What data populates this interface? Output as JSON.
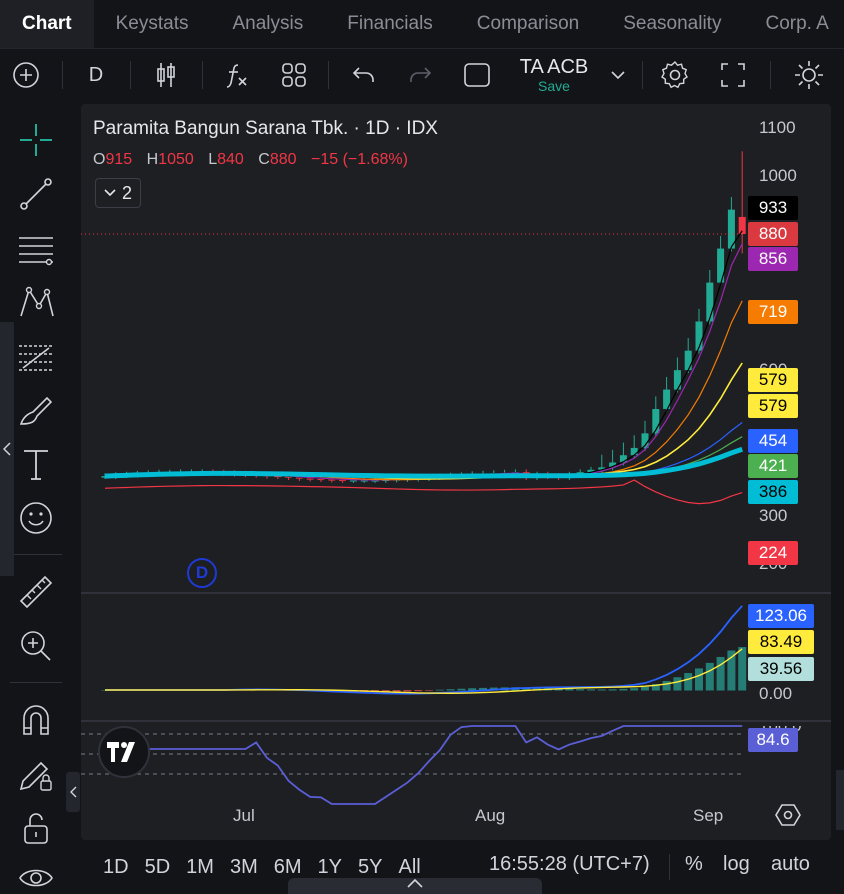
{
  "tabs": [
    {
      "label": "Chart",
      "active": true
    },
    {
      "label": "Keystats"
    },
    {
      "label": "Analysis"
    },
    {
      "label": "Financials"
    },
    {
      "label": "Comparison"
    },
    {
      "label": "Seasonality"
    },
    {
      "label": "Corp. A"
    }
  ],
  "toolbar": {
    "interval": "D",
    "symbol": "TA ACB",
    "save_label": "Save"
  },
  "legend": {
    "title": "Paramita Bangun Sarana Tbk. · 1D · IDX",
    "o_label": "O",
    "o_value": "915",
    "h_label": "H",
    "h_value": "1050",
    "l_label": "L",
    "l_value": "840",
    "c_label": "C",
    "c_value": "880",
    "change": "−15 (−1.68%)",
    "indicators_count": "2"
  },
  "price_axis": {
    "ticks": [
      "1100",
      "1000",
      "300",
      "200"
    ],
    "partial_ticks": [
      "600"
    ],
    "tags": [
      {
        "value": "933",
        "bg": "#000000",
        "fg": "#ffffff"
      },
      {
        "value": "880",
        "bg": "#d9393f",
        "fg": "#ffffff"
      },
      {
        "value": "856",
        "bg": "#9c27b0",
        "fg": "#ffffff"
      },
      {
        "value": "719",
        "bg": "#f57c00",
        "fg": "#ffffff"
      },
      {
        "value": "579",
        "bg": "#ffeb3b",
        "fg": "#000000"
      },
      {
        "value": "579",
        "bg": "#ffeb3b",
        "fg": "#000000"
      },
      {
        "value": "454",
        "bg": "#2962ff",
        "fg": "#ffffff"
      },
      {
        "value": "421",
        "bg": "#4caf50",
        "fg": "#ffffff"
      },
      {
        "value": "386",
        "bg": "#00bcd4",
        "fg": "#000000"
      },
      {
        "value": "224",
        "bg": "#f23645",
        "fg": "#ffffff"
      }
    ]
  },
  "macd_axis": {
    "tags": [
      {
        "value": "123.06",
        "bg": "#2962ff",
        "fg": "#ffffff"
      },
      {
        "value": "83.49",
        "bg": "#ffeb3b",
        "fg": "#000000"
      },
      {
        "value": "39.56",
        "bg": "#b2dfdb",
        "fg": "#000000"
      }
    ],
    "zero_label": "0.00"
  },
  "rsi_axis": {
    "tag": {
      "value": "84.6",
      "bg": "#5b5fd6",
      "fg": "#ffffff"
    },
    "partial_tick": "100.0"
  },
  "time_axis": [
    "Jul",
    "Aug",
    "Sep"
  ],
  "bottom": {
    "ranges": [
      "1D",
      "5D",
      "1M",
      "3M",
      "6M",
      "1Y",
      "5Y",
      "All"
    ],
    "clock": "16:55:28 (UTC+7)",
    "percent": "%",
    "log": "log",
    "auto": "auto"
  },
  "colors": {
    "up": "#22ab94",
    "down": "#f23645",
    "accent": "#2962ff"
  },
  "chart_data": {
    "type": "candlestick",
    "symbol": "Paramita Bangun Sarana Tbk.",
    "interval": "1D",
    "exchange": "IDX",
    "x_ticks": [
      "Jul",
      "Aug",
      "Sep"
    ],
    "y_ticks": [
      200,
      300,
      600,
      1000,
      1100
    ],
    "last_bar": {
      "open": 915,
      "high": 1050,
      "low": 840,
      "close": 880
    },
    "recent_closes_approx": [
      380,
      385,
      382,
      380,
      385,
      390,
      395,
      400,
      410,
      425,
      440,
      470,
      520,
      560,
      600,
      640,
      700,
      780,
      850,
      930,
      880
    ],
    "overlay_values": {
      "ma_black": 933,
      "ma_purple": 856,
      "ma_orange": 719,
      "bb_upper_yellow": 579,
      "ma_blue": 454,
      "ma_green": 421,
      "ma_cyan": 386,
      "bb_lower_red": 224
    },
    "macd": {
      "macd": 123.06,
      "signal": 83.49,
      "histogram": 39.56
    },
    "rsi": 84.6
  }
}
